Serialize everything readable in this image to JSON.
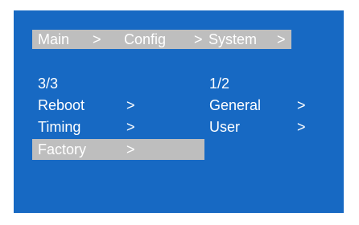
{
  "breadcrumb": {
    "items": [
      "Main",
      "Config",
      "System"
    ],
    "separator": ">"
  },
  "left_menu": {
    "page": "3/3",
    "items": [
      {
        "label": "Reboot",
        "arrow": ">",
        "selected": false
      },
      {
        "label": "Timing",
        "arrow": ">",
        "selected": false
      },
      {
        "label": "Factory",
        "arrow": ">",
        "selected": true
      }
    ]
  },
  "right_menu": {
    "page": "1/2",
    "items": [
      {
        "label": "General",
        "arrow": ">"
      },
      {
        "label": "User",
        "arrow": ">"
      }
    ]
  },
  "colors": {
    "screen_bg": "#1769c3",
    "highlight": "#bebebe",
    "text": "#ffffff"
  }
}
